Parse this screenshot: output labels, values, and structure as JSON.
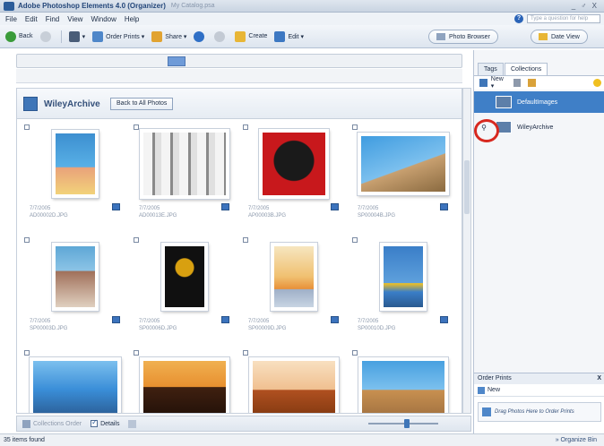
{
  "window": {
    "title": "Adobe Photoshop Elements 4.0 (Organizer)",
    "subtitle": "My Catalog.psa",
    "controls": "_ ♂ X"
  },
  "menu": [
    "File",
    "Edit",
    "Find",
    "View",
    "Window",
    "Help"
  ],
  "help_search": {
    "placeholder": "Type a question for help"
  },
  "toolbar": {
    "back": "Back",
    "order_prints": "Order Prints ▾",
    "share": "Share ▾",
    "create": "Create",
    "edit": "Edit ▾",
    "photo_browser": "Photo Browser",
    "date_view": "Date View"
  },
  "collection_header": {
    "name": "WileyArchive",
    "back_button": "Back to All Photos"
  },
  "photos": [
    {
      "date": "7/7/2005",
      "file": "AD00002D.JPG",
      "colors": [
        "#3d8fd0",
        "#e9a27a"
      ]
    },
    {
      "date": "7/7/2005",
      "file": "AD00013E.JPG",
      "colors": [
        "#f2f2f2",
        "#8a8a8a"
      ]
    },
    {
      "date": "7/7/2005",
      "file": "AP00003B.JPG",
      "colors": [
        "#c8181c",
        "#1a1a1a"
      ]
    },
    {
      "date": "7/7/2005",
      "file": "SP00004B.JPG",
      "colors": [
        "#3f9ce0",
        "#d94a2a"
      ]
    },
    {
      "date": "7/7/2005",
      "file": "SP00003D.JPG",
      "colors": [
        "#5ea7d6",
        "#c4a79a"
      ]
    },
    {
      "date": "7/7/2005",
      "file": "SP00006D.JPG",
      "colors": [
        "#101010",
        "#d8a010"
      ]
    },
    {
      "date": "7/7/2005",
      "file": "SP00009D.JPG",
      "colors": [
        "#f0c070",
        "#e89038"
      ]
    },
    {
      "date": "7/7/2005",
      "file": "SP00010D.JPG",
      "colors": [
        "#3a7ec8",
        "#f2c020"
      ]
    },
    {
      "date": "",
      "file": "",
      "colors": [
        "#3a8ed8",
        "#2a5a90"
      ]
    },
    {
      "date": "",
      "file": "",
      "colors": [
        "#e89030",
        "#402010"
      ]
    },
    {
      "date": "",
      "file": "",
      "colors": [
        "#f0c090",
        "#b05020"
      ]
    },
    {
      "date": "",
      "file": "",
      "colors": [
        "#48a0e0",
        "#c89050"
      ]
    }
  ],
  "bottom_bar": {
    "collections_order": "Collections Order",
    "details": "Details"
  },
  "status": {
    "items_found": "35 items found",
    "organize_bin": "» Organize Bin"
  },
  "right_panel": {
    "tabs": [
      "Tags",
      "Collections"
    ],
    "new_label": "New ▾",
    "collections": [
      {
        "name": "DefaultImages",
        "selected": true
      },
      {
        "name": "WileyArchive",
        "selected": false
      }
    ]
  },
  "order_prints": {
    "title": "Order Prints",
    "close": "X",
    "new_label": "New",
    "drop_hint": "Drag Photos Here to Order Prints"
  },
  "colors": {
    "accent": "#3f7fc7",
    "highlight_circle": "#d7281f"
  }
}
